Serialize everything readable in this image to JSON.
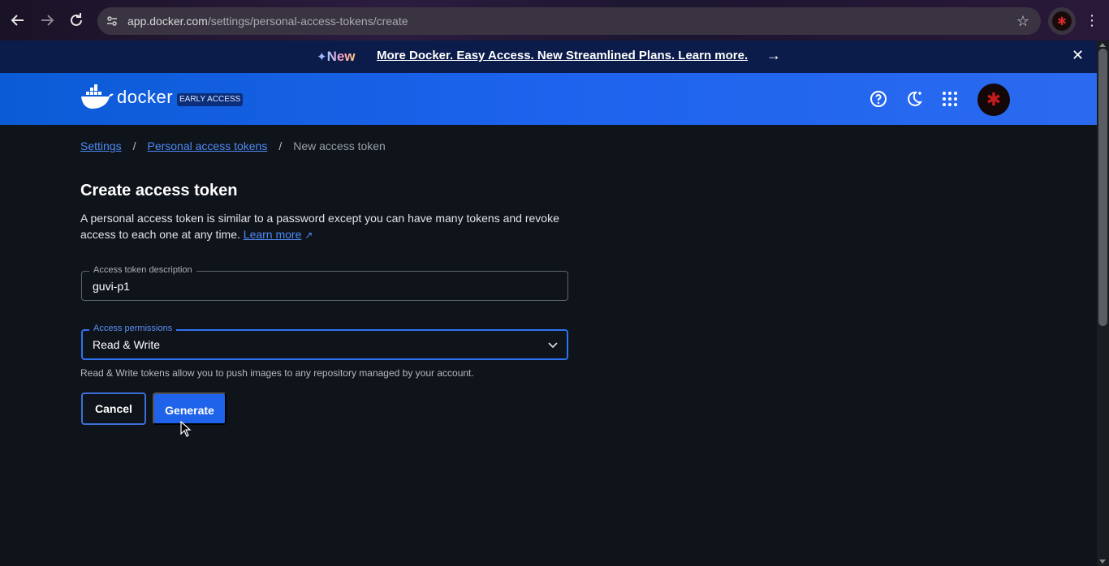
{
  "browser": {
    "url_host": "app.docker.com",
    "url_path": "/settings/personal-access-tokens/create",
    "icons": [
      "back-icon",
      "forward-icon",
      "reload-icon",
      "site-info-icon",
      "bookmark-star-icon",
      "profile-avatar",
      "menu-kebab-icon"
    ]
  },
  "banner": {
    "badge": "New",
    "message": "More Docker. Easy Access. New Streamlined Plans. Learn more.",
    "arrow": "→",
    "close": "✕"
  },
  "header": {
    "brand": "docker",
    "badge": "EARLY ACCESS",
    "icons": [
      "help-icon",
      "theme-toggle-icon",
      "apps-grid-icon",
      "user-avatar"
    ]
  },
  "breadcrumb": {
    "items": [
      "Settings",
      "Personal access tokens",
      "New access token"
    ],
    "separator": "/"
  },
  "page": {
    "title": "Create access token",
    "description": "A personal access token is similar to a password except you can have many tokens and revoke access to each one at any time.",
    "learn_more": "Learn more"
  },
  "form": {
    "description_label": "Access token description",
    "description_value": "guvi-p1",
    "permissions_label": "Access permissions",
    "permissions_value": "Read & Write",
    "permissions_helper": "Read & Write tokens allow you to push images to any repository managed by your account.",
    "cancel_label": "Cancel",
    "generate_label": "Generate"
  },
  "colors": {
    "accent": "#1d63ed",
    "link": "#4d8bf5",
    "background": "#0f131a",
    "banner_bg": "#0b1b4a"
  }
}
